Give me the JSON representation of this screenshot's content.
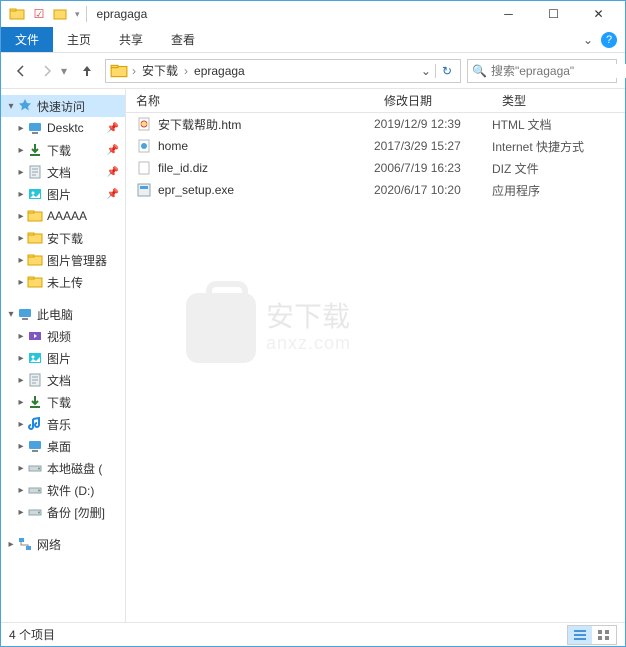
{
  "window": {
    "title": "epragaga"
  },
  "ribbon": {
    "file": "文件",
    "home": "主页",
    "share": "共享",
    "view": "查看"
  },
  "breadcrumbs": [
    "安下载",
    "epragaga"
  ],
  "search": {
    "placeholder": "搜索\"epragaga\""
  },
  "columns": {
    "name": "名称",
    "modified": "修改日期",
    "type": "类型"
  },
  "sidebar": {
    "quick_access": "快速访问",
    "quick_items": [
      {
        "label": "Desktc",
        "icon": "desktop",
        "pinned": true
      },
      {
        "label": "下载",
        "icon": "downloads",
        "pinned": true
      },
      {
        "label": "文档",
        "icon": "doc",
        "pinned": true
      },
      {
        "label": "图片",
        "icon": "pictures",
        "pinned": true
      },
      {
        "label": "AAAAA",
        "icon": "folder",
        "pinned": false
      },
      {
        "label": "安下载",
        "icon": "folder",
        "pinned": false
      },
      {
        "label": "图片管理器",
        "icon": "folder",
        "pinned": false
      },
      {
        "label": "未上传",
        "icon": "folder",
        "pinned": false
      }
    ],
    "this_pc": "此电脑",
    "pc_items": [
      {
        "label": "视频",
        "icon": "video"
      },
      {
        "label": "图片",
        "icon": "pictures"
      },
      {
        "label": "文档",
        "icon": "doc"
      },
      {
        "label": "下载",
        "icon": "downloads"
      },
      {
        "label": "音乐",
        "icon": "music"
      },
      {
        "label": "桌面",
        "icon": "desktop"
      },
      {
        "label": "本地磁盘 (",
        "icon": "drive"
      },
      {
        "label": "软件 (D:)",
        "icon": "drive"
      },
      {
        "label": "备份 [勿删]",
        "icon": "drive"
      }
    ],
    "network": "网络"
  },
  "files": [
    {
      "name": "epr_setup.exe",
      "date": "2020/6/17 10:20",
      "type": "应用程序",
      "icon": "exe"
    },
    {
      "name": "file_id.diz",
      "date": "2006/7/19 16:23",
      "type": "DIZ 文件",
      "icon": "file"
    },
    {
      "name": "home",
      "date": "2017/3/29 15:27",
      "type": "Internet 快捷方式",
      "icon": "url"
    },
    {
      "name": "安下载帮助.htm",
      "date": "2019/12/9 12:39",
      "type": "HTML 文档",
      "icon": "html"
    }
  ],
  "statusbar": {
    "count": "4 个项目"
  },
  "watermark": {
    "title": "安下载",
    "sub": "anxz.com"
  }
}
